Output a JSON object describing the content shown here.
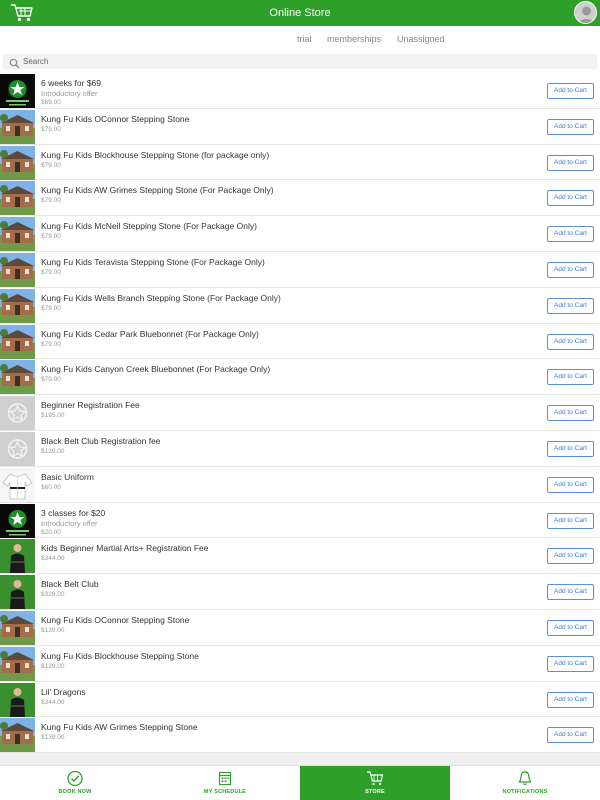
{
  "header": {
    "title": "Online Store"
  },
  "filters": [
    "trial",
    "memberships",
    "Unassigned"
  ],
  "search": {
    "placeholder": "Search"
  },
  "products": [
    {
      "title": "6 weeks for $69",
      "subtitle": "Introductory offer",
      "price": "$69.00",
      "button": "Add to Cart",
      "thumb": "logo"
    },
    {
      "title": "Kung Fu Kids OConnor Stepping Stone",
      "price": "$79.00",
      "button": "Add to Cart",
      "thumb": "building"
    },
    {
      "title": "Kung Fu Kids Blockhouse Stepping Stone (for package only)",
      "price": "$79.00",
      "button": "Add to Cart",
      "thumb": "building"
    },
    {
      "title": "Kung Fu Kids AW Grimes Stepping Stone (For Package Only)",
      "price": "$79.00",
      "button": "Add to Cart",
      "thumb": "building"
    },
    {
      "title": "Kung Fu Kids McNeil Stepping Stone (For Package Only)",
      "price": "$79.00",
      "button": "Add to Cart",
      "thumb": "building"
    },
    {
      "title": "Kung Fu Kids Teravista Stepping Stone (For Package Only)",
      "price": "$79.00",
      "button": "Add to Cart",
      "thumb": "building"
    },
    {
      "title": "Kung Fu Kids Wells Branch Stepping Stone (For Package Only)",
      "price": "$79.00",
      "button": "Add to Cart",
      "thumb": "building"
    },
    {
      "title": "Kung Fu Kids Cedar Park Bluebonnet (For Package Only)",
      "price": "$79.00",
      "button": "Add to Cart",
      "thumb": "building"
    },
    {
      "title": "Kung Fu Kids Canyon Creek Bluebonnet (For Package Only)",
      "price": "$79.00",
      "button": "Add to Cart",
      "thumb": "building"
    },
    {
      "title": "Beginner Registration Fee",
      "price": "$195.00",
      "button": "Add to Cart",
      "thumb": "placeholder"
    },
    {
      "title": "Black Belt Club Registration fee",
      "price": "$139.00",
      "button": "Add to Cart",
      "thumb": "placeholder"
    },
    {
      "title": "Basic Uniform",
      "price": "$60.00",
      "button": "Add to Cart",
      "thumb": "uniform"
    },
    {
      "title": "3 classes for $20",
      "subtitle": "Introductory offer",
      "price": "$20.00",
      "button": "Add to Cart",
      "thumb": "logo"
    },
    {
      "title": "Kids Beginner Martial Arts+ Registration Fee",
      "price": "$344.00",
      "button": "Add to Cart",
      "thumb": "person"
    },
    {
      "title": "Black Belt Club",
      "price": "$328.00",
      "button": "Add to Cart",
      "thumb": "person"
    },
    {
      "title": "Kung Fu Kids OConnor Stepping Stone",
      "price": "$139.00",
      "button": "Add to Cart",
      "thumb": "building"
    },
    {
      "title": "Kung Fu Kids Blockhouse Stepping Stone",
      "price": "$139.00",
      "button": "Add to Cart",
      "thumb": "building"
    },
    {
      "title": "Lil' Dragons",
      "price": "$344.00",
      "button": "Add to Cart",
      "thumb": "person"
    },
    {
      "title": "Kung Fu Kids AW Grimes Stepping Stone",
      "price": "$139.00",
      "button": "Add to Cart",
      "thumb": "building"
    }
  ],
  "tabs": [
    {
      "label": "BOOK NOW",
      "icon": "check-circle-icon",
      "active": false
    },
    {
      "label": "MY SCHEDULE",
      "icon": "calendar-icon",
      "active": false
    },
    {
      "label": "STORE",
      "icon": "cart-icon",
      "active": true
    },
    {
      "label": "NOTIFICATIONS",
      "icon": "bell-icon",
      "active": false
    }
  ],
  "colors": {
    "brand_green": "#2ea02a",
    "button_blue": "#3d7bd1"
  }
}
